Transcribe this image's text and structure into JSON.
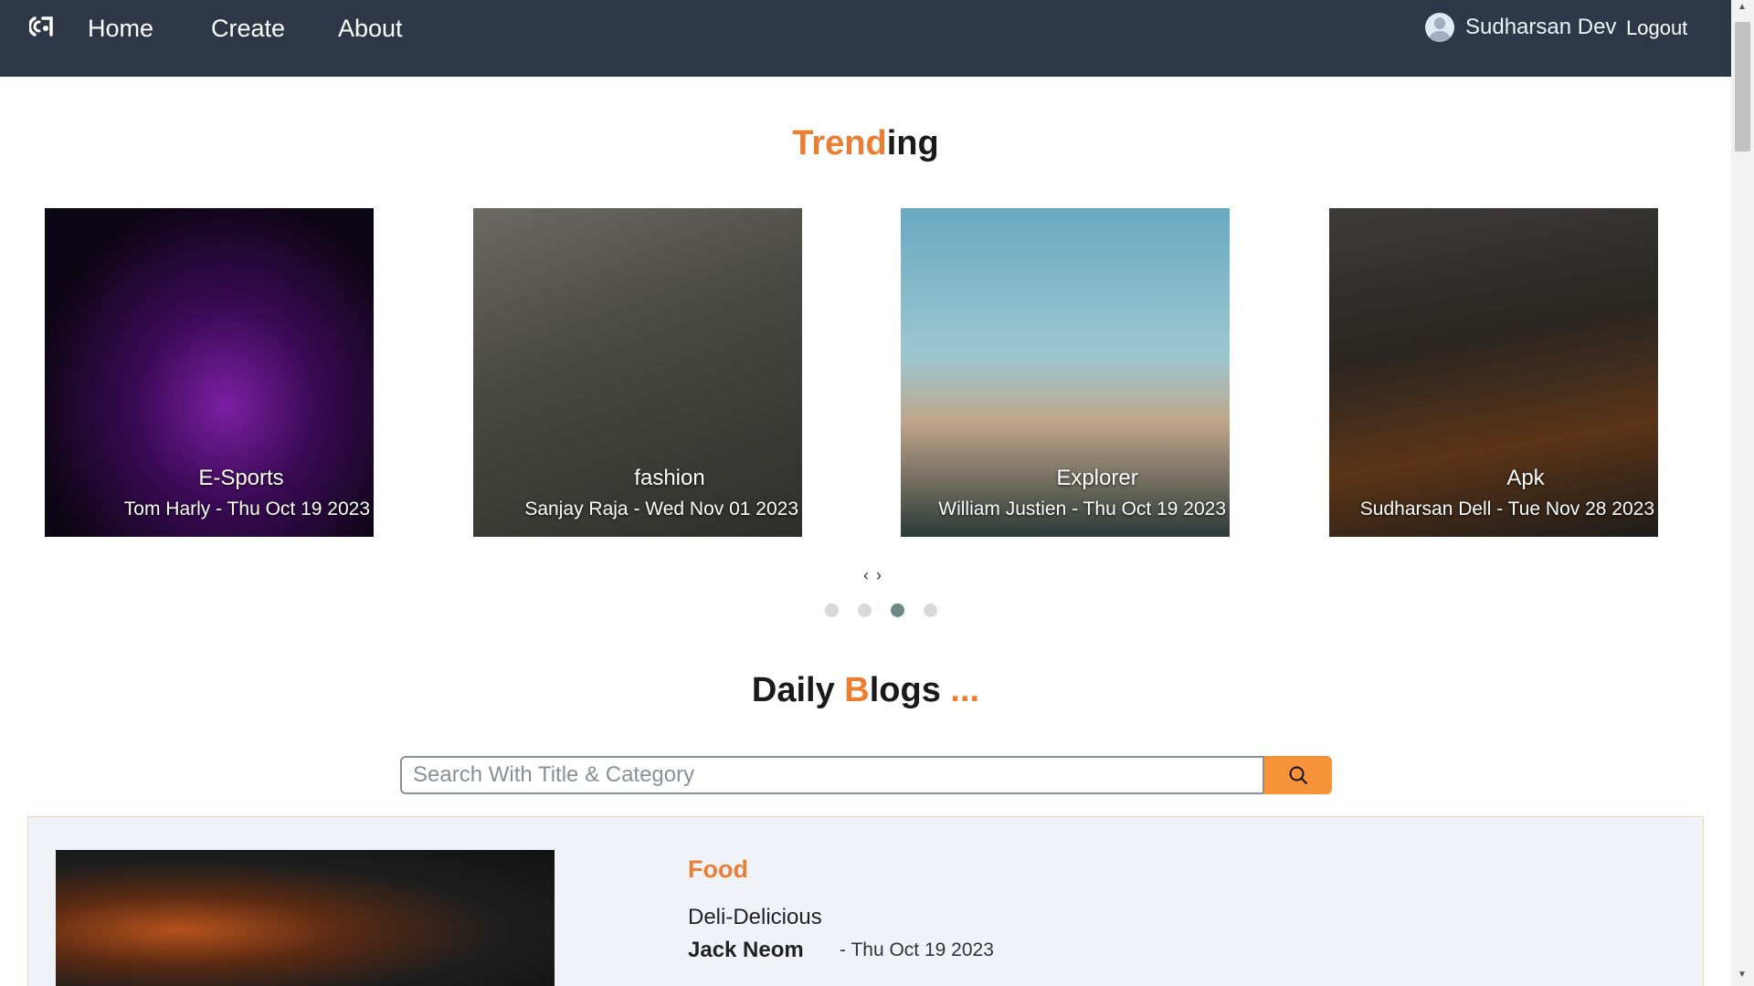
{
  "nav": {
    "home": "Home",
    "create": "Create",
    "about": "About",
    "user_name": "Sudharsan Dev",
    "logout": "Logout"
  },
  "trending": {
    "title_accent": "Trend",
    "title_rest": "ing",
    "cards": [
      {
        "category": "E-Sports",
        "meta": "Tom Harly - Thu Oct 19 2023"
      },
      {
        "category": "fashion",
        "meta": "Sanjay Raja - Wed Nov 01 2023"
      },
      {
        "category": "Explorer",
        "meta": "William Justien - Thu Oct 19 2023"
      },
      {
        "category": "Apk",
        "meta": "Sudharsan Dell - Tue Nov 28 2023"
      }
    ],
    "prev_label": "‹",
    "next_label": "›",
    "active_dot": 3,
    "dot_count": 4
  },
  "blogs": {
    "title_part1": "Daily ",
    "title_accent": "B",
    "title_part2": "logs ",
    "title_dots": "...",
    "search_placeholder": "Search With Title & Category",
    "first_post": {
      "category": "Food",
      "title": "Deli-Delicious",
      "author": "Jack Neom",
      "date": "- Thu Oct 19 2023"
    }
  },
  "colors": {
    "navbar": "#2d3748",
    "accent": "#ed7d31",
    "search_button": "#f6933a"
  }
}
